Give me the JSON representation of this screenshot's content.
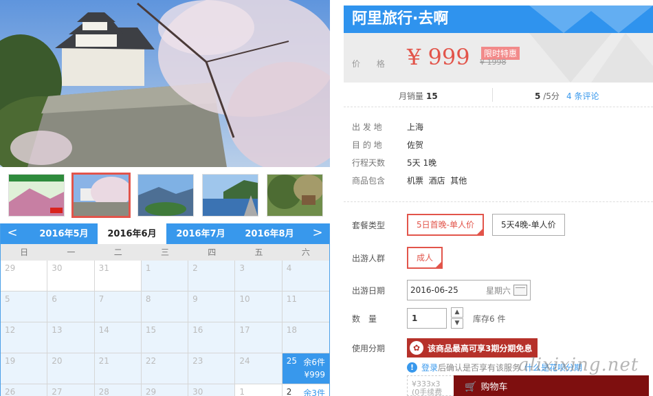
{
  "product": {
    "title": "阿里旅行·去啊",
    "price_label": "价 格",
    "price": "¥ 999",
    "promo_tag": "限时特惠",
    "old_price": "¥ 1998",
    "sales_label": "月销量",
    "sales_count": "15",
    "score": "5",
    "score_suffix": "/5分",
    "reviews": "4 条评论"
  },
  "info": [
    {
      "key": "出 发 地",
      "value": "上海"
    },
    {
      "key": "目 的 地",
      "value": "佐贺"
    },
    {
      "key": "行程天数",
      "value": "5天 1晚"
    },
    {
      "key": "商品包含",
      "value": "机票  酒店  其他"
    }
  ],
  "options": {
    "package_label": "套餐类型",
    "packages": [
      "5日首晚-单人价",
      "5天4晚-单人价"
    ],
    "crowd_label": "出游人群",
    "crowd": "成人",
    "date_label": "出游日期",
    "date_value": "2016-06-25",
    "date_weekday": "星期六",
    "qty_label": "数　量",
    "qty_value": "1",
    "stock": "库存6 件",
    "install_label": "使用分期",
    "install_button": "该商品最高可享3期分期免息",
    "install_icon": "taobao-icon",
    "notice_login": "登录",
    "notice_text": "后确认是否享有该服务",
    "notice_link": "什么是花呗分期",
    "install_box_line1": "¥333x3",
    "install_box_line2": "(0手续费",
    "cart_button": "购物车",
    "watermark": "alixixing.net"
  },
  "calendar": {
    "prev": "<",
    "next": ">",
    "months": [
      "2016年5月",
      "2016年6月",
      "2016年7月",
      "2016年8月"
    ],
    "active_month": 1,
    "weekdays": [
      "日",
      "一",
      "二",
      "三",
      "四",
      "五",
      "六"
    ],
    "cells": [
      {
        "d": "29",
        "t": "out"
      },
      {
        "d": "30",
        "t": "out"
      },
      {
        "d": "31",
        "t": "out"
      },
      {
        "d": "1",
        "t": "in"
      },
      {
        "d": "2",
        "t": "in"
      },
      {
        "d": "3",
        "t": "in"
      },
      {
        "d": "4",
        "t": "in"
      },
      {
        "d": "5",
        "t": "in"
      },
      {
        "d": "6",
        "t": "in"
      },
      {
        "d": "7",
        "t": "in"
      },
      {
        "d": "8",
        "t": "in"
      },
      {
        "d": "9",
        "t": "in"
      },
      {
        "d": "10",
        "t": "in"
      },
      {
        "d": "11",
        "t": "in"
      },
      {
        "d": "12",
        "t": "in"
      },
      {
        "d": "13",
        "t": "in"
      },
      {
        "d": "14",
        "t": "in"
      },
      {
        "d": "15",
        "t": "in"
      },
      {
        "d": "16",
        "t": "in"
      },
      {
        "d": "17",
        "t": "in"
      },
      {
        "d": "18",
        "t": "in"
      },
      {
        "d": "19",
        "t": "in"
      },
      {
        "d": "20",
        "t": "in"
      },
      {
        "d": "21",
        "t": "in"
      },
      {
        "d": "22",
        "t": "in"
      },
      {
        "d": "23",
        "t": "in"
      },
      {
        "d": "24",
        "t": "in"
      },
      {
        "d": "25",
        "t": "sel",
        "stock": "余6件",
        "price": "¥999"
      },
      {
        "d": "26",
        "t": "in"
      },
      {
        "d": "27",
        "t": "in"
      },
      {
        "d": "28",
        "t": "in"
      },
      {
        "d": "29",
        "t": "in"
      },
      {
        "d": "30",
        "t": "in"
      },
      {
        "d": "1",
        "t": "out"
      },
      {
        "d": "2",
        "t": "avail",
        "stock": "余3件",
        "price": ""
      }
    ]
  },
  "thumbnails": [
    "thumb-poster",
    "thumb-castle-sakura",
    "thumb-mountain",
    "thumb-coast",
    "thumb-garden"
  ],
  "colors": {
    "accent": "#3898ec",
    "price": "#e2544a",
    "install": "#b6312a",
    "cart": "#7e0f0f"
  }
}
